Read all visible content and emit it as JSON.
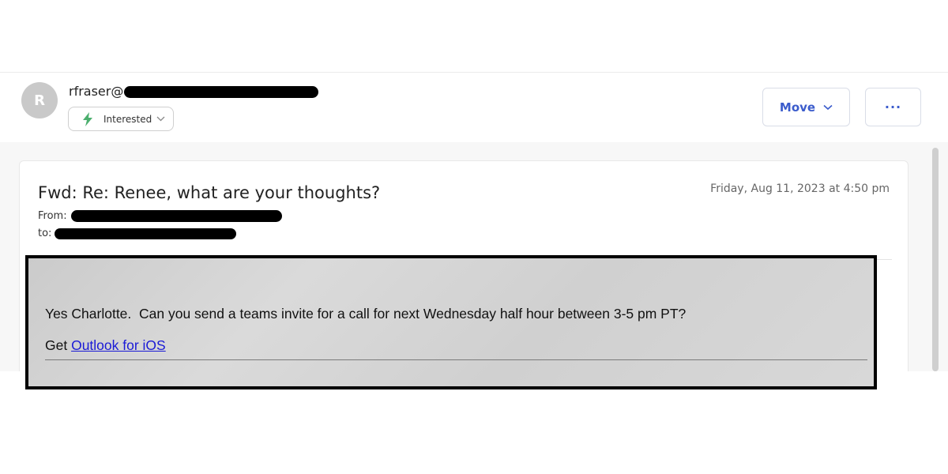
{
  "header": {
    "avatar_letter": "R",
    "sender_prefix": "rfraser@",
    "tag_label": "Interested",
    "move_label": "Move",
    "more_label": "···"
  },
  "email": {
    "subject": "Fwd: Re: Renee, what are your thoughts?",
    "date": "Friday, Aug 11, 2023 at 4:50 pm",
    "from_label": "From:",
    "to_label": "to:"
  },
  "body": {
    "message": "Yes Charlotte.  Can you send a teams invite for a call for next Wednesday half hour between 3-5 pm PT?",
    "signature_prefix": "Get ",
    "signature_link": "Outlook for iOS"
  },
  "colors": {
    "accent": "#3b5ccc",
    "tag_icon": "#4caf6e",
    "link": "#1a1ad6"
  }
}
